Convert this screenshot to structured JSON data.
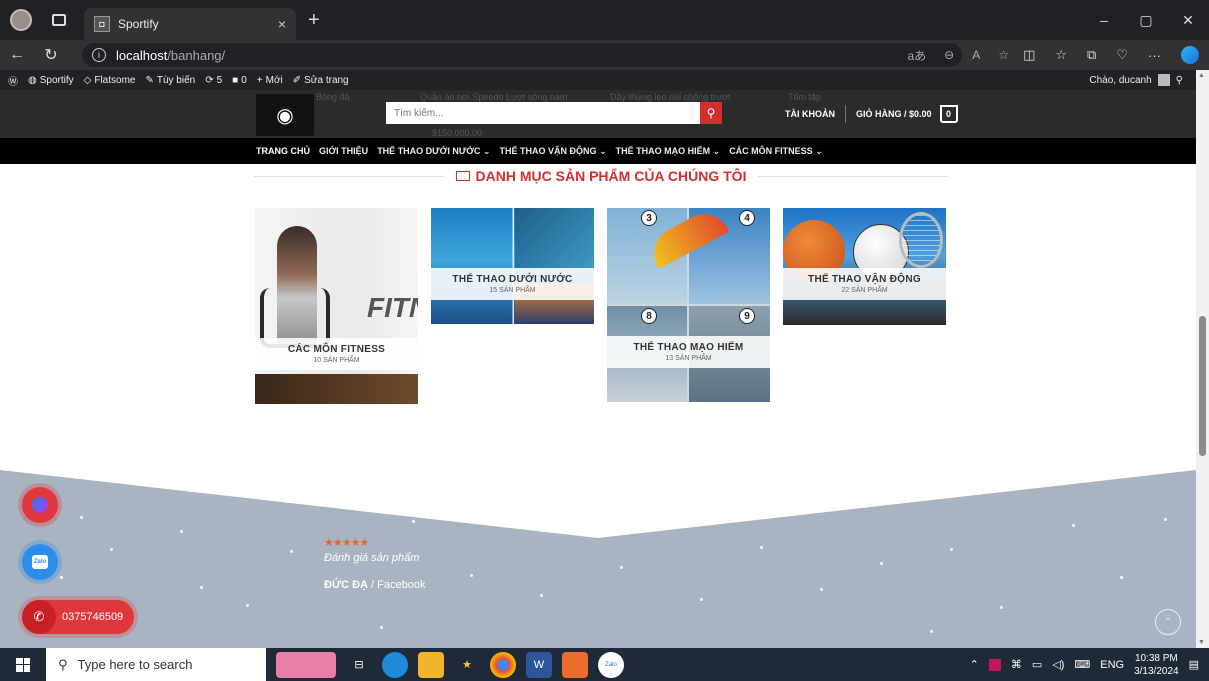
{
  "browser": {
    "tab_title": "Sportify",
    "tab_close": "×",
    "new_tab": "+",
    "url_host": "localhost",
    "url_path": "/banhang/",
    "window_controls": [
      "–",
      "▢",
      "✕"
    ],
    "url_icons": [
      "aあ",
      "⊖",
      "A",
      "☆"
    ],
    "right_icons": [
      "◫",
      "☆",
      "⧉",
      "♡",
      "···"
    ]
  },
  "wp_admin_bar": {
    "items": [
      "Sportify",
      "Flatsome",
      "Tùy biến",
      "5",
      "0",
      "Mới",
      "Sửa trang"
    ],
    "greeting": "Chào, ducanh"
  },
  "header": {
    "search_placeholder": "Tìm kiếm...",
    "search_icon": "search-icon",
    "account_label": "TÀI KHOẢN",
    "cart_label": "GIỎ HÀNG / $0.00",
    "cart_count": "0",
    "ghost_texts": [
      "Bóng đá",
      "Quần áo bơi Speedo Lượt sóng nam",
      "Dây thừng leo núi chống trượt",
      "Tấm tập",
      "$150,000.00"
    ]
  },
  "nav": {
    "items": [
      {
        "label": "TRANG CHỦ",
        "active": true,
        "dropdown": false
      },
      {
        "label": "GIỚI THIỆU",
        "active": false,
        "dropdown": false
      },
      {
        "label": "THỂ THAO DƯỚI NƯỚC",
        "active": false,
        "dropdown": true
      },
      {
        "label": "THỂ THAO VẬN ĐỘNG",
        "active": false,
        "dropdown": true
      },
      {
        "label": "THỂ THAO MẠO HIỂM",
        "active": false,
        "dropdown": true
      },
      {
        "label": "CÁC MÔN FITNESS",
        "active": false,
        "dropdown": true
      }
    ]
  },
  "section": {
    "title": "DANH MỤC SẢN PHẨM CỦA CHÚNG TÔI",
    "categories": [
      {
        "name": "CÁC MÔN FITNESS",
        "count": "10 SẢN PHẨM",
        "image_text": "FITN"
      },
      {
        "name": "THỂ THAO DƯỚI NƯỚC",
        "count": "15 SẢN PHẨM"
      },
      {
        "name": "THỂ THAO MẠO HIỂM",
        "count": "13 SẢN PHẨM",
        "badges": [
          "3",
          "4",
          "8",
          "9"
        ]
      },
      {
        "name": "THỂ THAO VẬN ĐỘNG",
        "count": "22 SẢN PHẨM"
      }
    ]
  },
  "footer": {
    "stars": "★★★★★",
    "review_text": "Đánh giá sản phẩm",
    "author_name": "ĐỨC ĐẠ",
    "author_source": " / Facebook"
  },
  "floating": {
    "phone_number": "0375746509",
    "zalo_label": "Zalo"
  },
  "taskbar": {
    "search_placeholder": "Type here to search",
    "language": "ENG",
    "time": "10:38 PM",
    "date": "3/13/2024"
  }
}
